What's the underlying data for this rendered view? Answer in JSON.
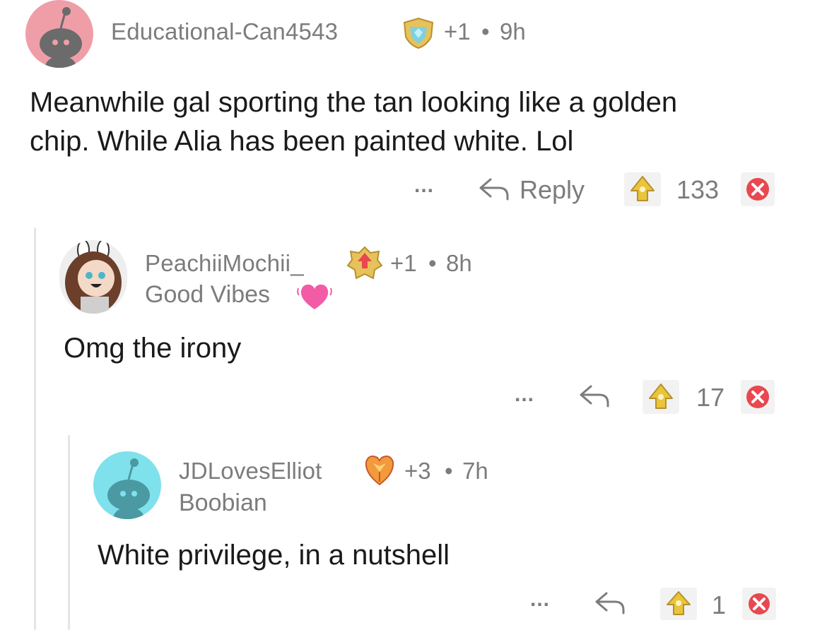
{
  "comments": [
    {
      "username": "Educational-Can4543",
      "award_count": "+1",
      "separator": "•",
      "age": "9h",
      "flair": "",
      "body_lines": [
        "Meanwhile gal sporting the tan looking like a golden",
        "chip.  While Alia has been painted white.  Lol"
      ],
      "more_label": "...",
      "reply_label": "Reply",
      "score": "133",
      "avatar_color": "#ef9ea8"
    },
    {
      "username": "PeachiiMochii_",
      "award_count": "+1",
      "separator": "•",
      "age": "8h",
      "flair": "Good Vibes",
      "body_lines": [
        "Omg the irony"
      ],
      "more_label": "...",
      "score": "17"
    },
    {
      "username": "JDLovesElliot",
      "award_count": "+3",
      "separator": "•",
      "age": "7h",
      "flair": "Boobian",
      "body_lines": [
        "White privilege, in a nutshell"
      ],
      "more_label": "...",
      "score": "1",
      "avatar_color": "#7fe1ec"
    }
  ],
  "icons": {
    "reply": "reply-arrow-icon",
    "upvote": "gold-upvote-icon",
    "downvote": "red-x-downvote-icon",
    "heart": "heart-icon"
  },
  "colors": {
    "meta_text": "#7c7c7c",
    "body_text": "#1a1a1b",
    "thread_line": "#e5e5e5",
    "downvote_red": "#e8484f",
    "upvote_gold": "#e8c53a"
  }
}
